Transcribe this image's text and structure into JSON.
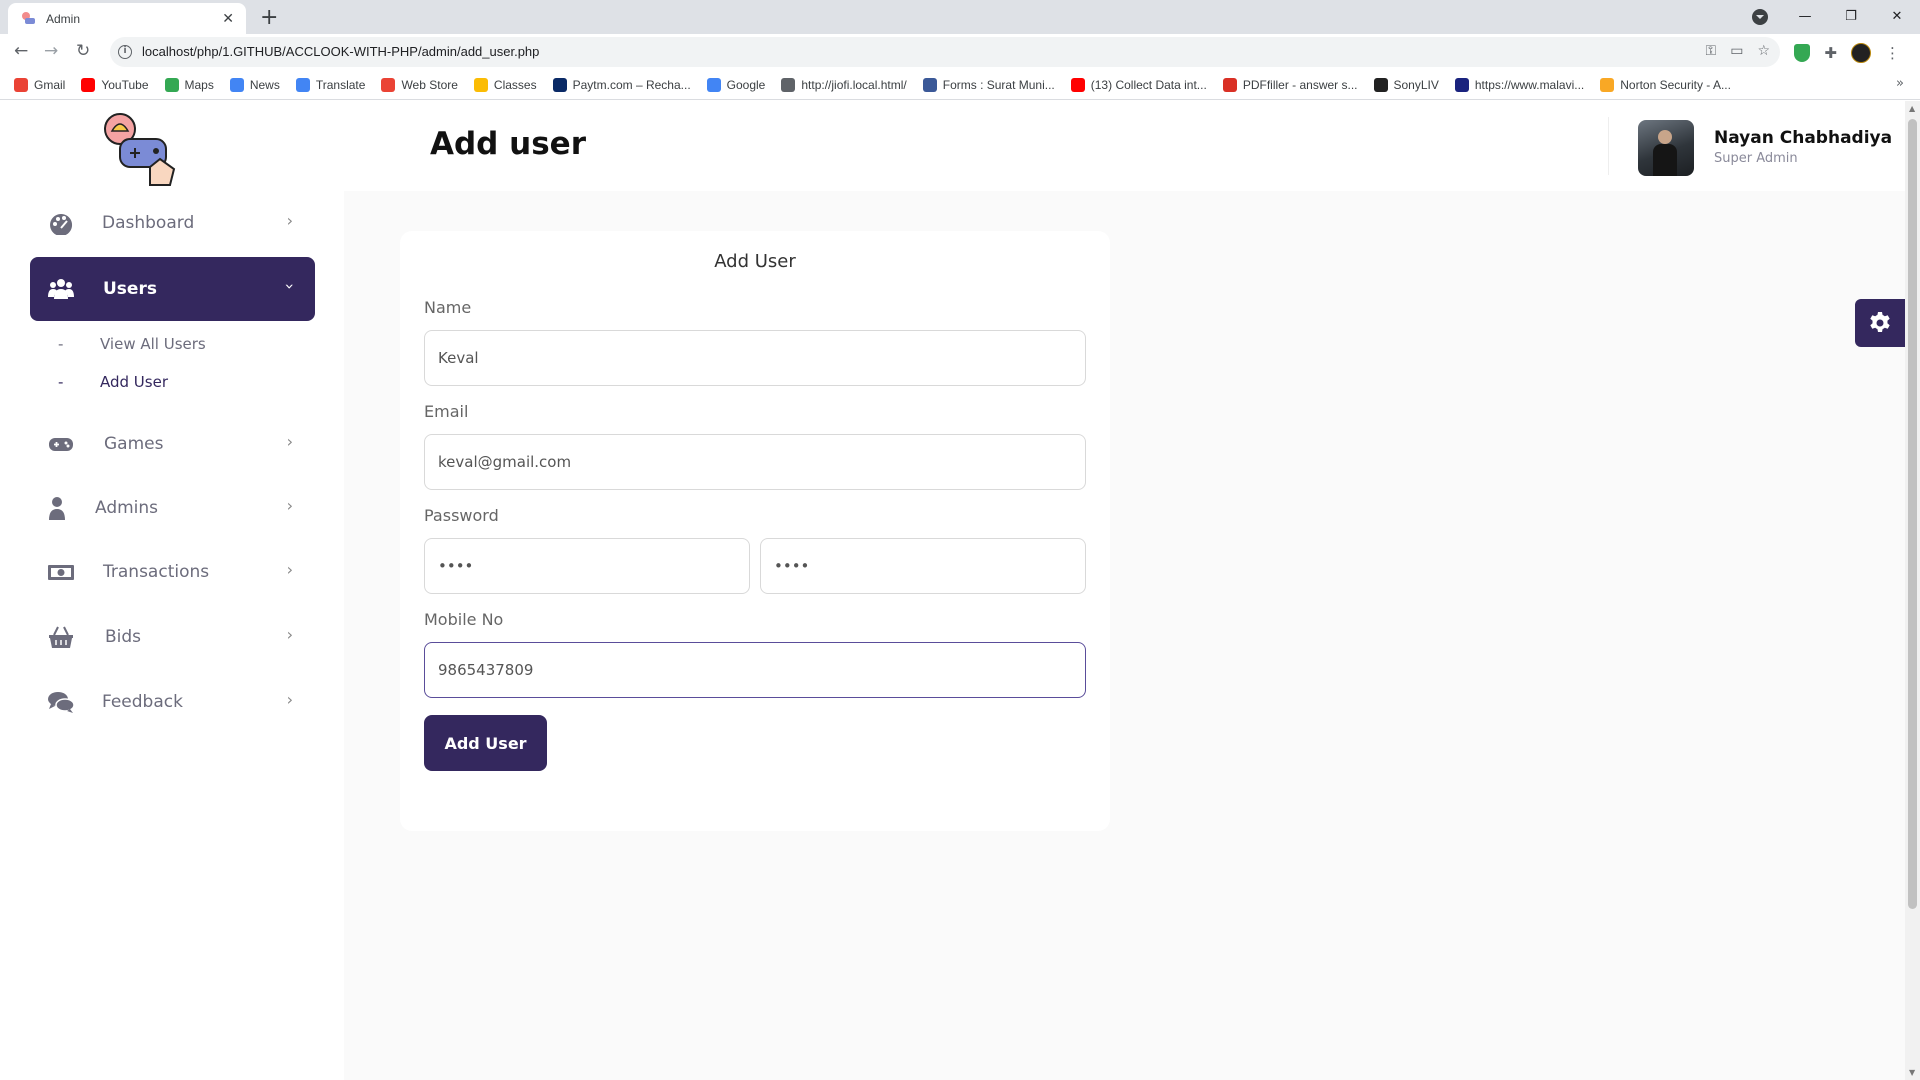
{
  "browser": {
    "tab_title": "Admin",
    "url": "localhost/php/1.GITHUB/ACCLOOK-WITH-PHP/admin/add_user.php",
    "bookmarks": [
      {
        "label": "Gmail",
        "color": "#ea4335"
      },
      {
        "label": "YouTube",
        "color": "#ff0000"
      },
      {
        "label": "Maps",
        "color": "#34a853"
      },
      {
        "label": "News",
        "color": "#4285f4"
      },
      {
        "label": "Translate",
        "color": "#4285f4"
      },
      {
        "label": "Web Store",
        "color": "#ea4335"
      },
      {
        "label": "Classes",
        "color": "#fbbc04"
      },
      {
        "label": "Paytm.com – Recha...",
        "color": "#0a2a66"
      },
      {
        "label": "Google",
        "color": "#4285f4"
      },
      {
        "label": "http://jiofi.local.html/",
        "color": "#5f6368"
      },
      {
        "label": "Forms : Surat Muni...",
        "color": "#3b5998"
      },
      {
        "label": "(13) Collect Data int...",
        "color": "#ff0000"
      },
      {
        "label": "PDFfiller - answer s...",
        "color": "#d93025"
      },
      {
        "label": "SonyLIV",
        "color": "#222222"
      },
      {
        "label": "https://www.malavi...",
        "color": "#1a237e"
      },
      {
        "label": "Norton Security - A...",
        "color": "#f9a825"
      }
    ]
  },
  "sidebar": {
    "items": [
      {
        "label": "Dashboard",
        "icon": "palette-icon"
      },
      {
        "label": "Users",
        "icon": "users-icon",
        "active": true
      },
      {
        "label": "Games",
        "icon": "gamepad-icon"
      },
      {
        "label": "Admins",
        "icon": "user-icon"
      },
      {
        "label": "Transactions",
        "icon": "money-bill-icon"
      },
      {
        "label": "Bids",
        "icon": "basket-icon"
      },
      {
        "label": "Feedback",
        "icon": "comments-icon"
      }
    ],
    "users_submenu": [
      "View All Users",
      "Add User"
    ],
    "dash": "-"
  },
  "header": {
    "title": "Add user",
    "user_name": "Nayan Chabhadiya",
    "user_role": "Super Admin"
  },
  "form": {
    "title": "Add User",
    "name_label": "Name",
    "name_value": "Keval",
    "email_label": "Email",
    "email_value": "keval@gmail.com",
    "password_label": "Password",
    "password_value": "••••",
    "confirm_password_value": "••••",
    "mobile_label": "Mobile No",
    "mobile_value": "9865437809",
    "submit_label": "Add User"
  },
  "colors": {
    "primary": "#34285e",
    "muted_text": "#6c6c7c",
    "background": "#fafafa"
  }
}
